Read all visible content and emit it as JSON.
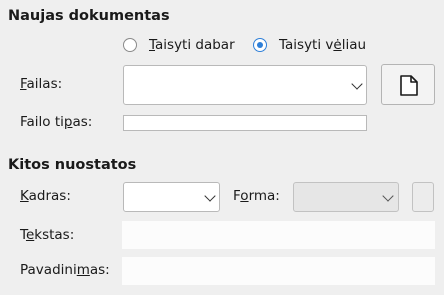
{
  "new_document": {
    "title": "Naujas dokumentas",
    "options": [
      {
        "label": "Taisyti dabar",
        "mnemonic": "T",
        "rest": "aisyti dabar",
        "selected": false
      },
      {
        "label": "Taisyti vėliau",
        "mnemonic": "",
        "rest": "",
        "selected": true
      }
    ],
    "file_label_mn": "F",
    "file_label_rest": "ailas:",
    "file_value": "",
    "file_type_label_a": "Failo ti",
    "file_type_label_mn": "p",
    "file_type_label_b": "as:",
    "file_type_value": ""
  },
  "other_settings": {
    "title": "Kitos nuostatos",
    "frame_label_mn": "K",
    "frame_label_rest": "adras:",
    "frame_value": "",
    "shape_label_a": "F",
    "shape_label_mn": "o",
    "shape_label_b": "rma:",
    "shape_value": "",
    "text_label_a": "T",
    "text_label_mn": "e",
    "text_label_b": "kstas:",
    "text_value": "",
    "name_label_a": "Pavadini",
    "name_label_mn": "m",
    "name_label_b": "as:",
    "name_value": ""
  },
  "icons": {
    "new_file": "new-document-icon",
    "dropdown": "chevron-down-icon"
  }
}
